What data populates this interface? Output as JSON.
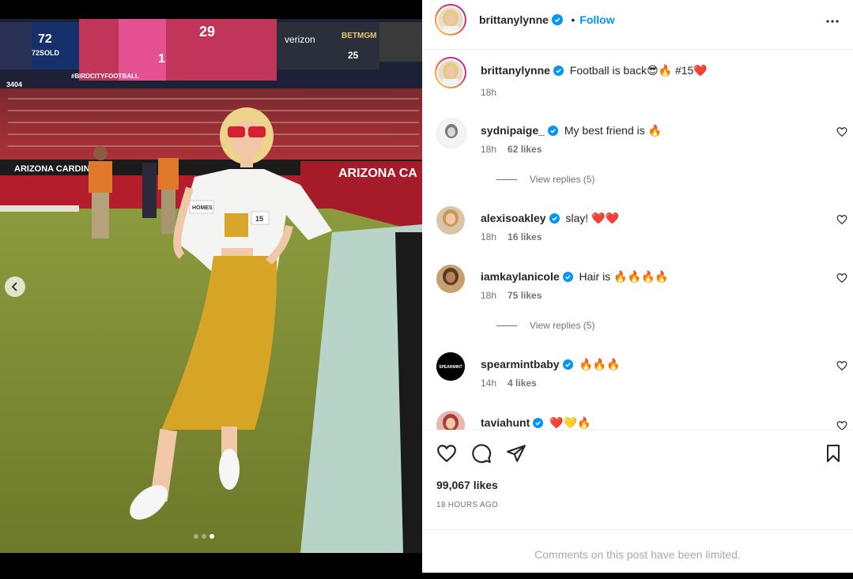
{
  "post": {
    "username": "brittanylynne",
    "follow_label": "Follow",
    "separator": "•",
    "caption": "Football is back😎🔥 #15❤️",
    "caption_time": "18h",
    "likes": "99,067 likes",
    "posted_ago": "18 HOURS AGO",
    "comments_limited": "Comments on this post have been limited.",
    "carousel": {
      "current_slide": 3,
      "total_slides": 3
    }
  },
  "photo": {
    "jumbotron_texts": [
      "72",
      "72SOLD",
      "verizon",
      "BETMGM",
      "#BIRDCITYFOOTBALL",
      "25",
      "29",
      "1"
    ],
    "banner_left": "ARIZONA CARDINALS",
    "banner_right": "ARIZONA CA",
    "shirt_patch_left": "HOMES",
    "shirt_patch_right": "15",
    "stand_sign": "3404"
  },
  "comments": [
    {
      "username": "sydnipaige_",
      "text": "My best friend is 🔥",
      "time": "18h",
      "likes": "62 likes",
      "replies": "View replies (5)"
    },
    {
      "username": "alexisoakley",
      "text": "slay! ❤️❤️",
      "time": "18h",
      "likes": "16 likes",
      "replies": ""
    },
    {
      "username": "iamkaylanicole",
      "text": "Hair is 🔥🔥🔥🔥",
      "time": "18h",
      "likes": "75 likes",
      "replies": "View replies (5)"
    },
    {
      "username": "spearmintbaby",
      "text": "🔥🔥🔥",
      "time": "14h",
      "likes": "4 likes",
      "replies": ""
    },
    {
      "username": "taviahunt",
      "text": "❤️💛🔥",
      "time": "",
      "likes": "",
      "replies": ""
    }
  ],
  "avatars": {
    "spearmint_label": "SPEARMINT"
  },
  "colors": {
    "accent": "#0095f6",
    "verified": "#0095f6",
    "ring_start": "#feda75",
    "ring_end": "#962fbf"
  },
  "icons": [
    "heart-icon",
    "comment-icon",
    "share-icon",
    "bookmark-icon",
    "more-icon",
    "chevron-left-icon",
    "verified-badge-icon"
  ]
}
